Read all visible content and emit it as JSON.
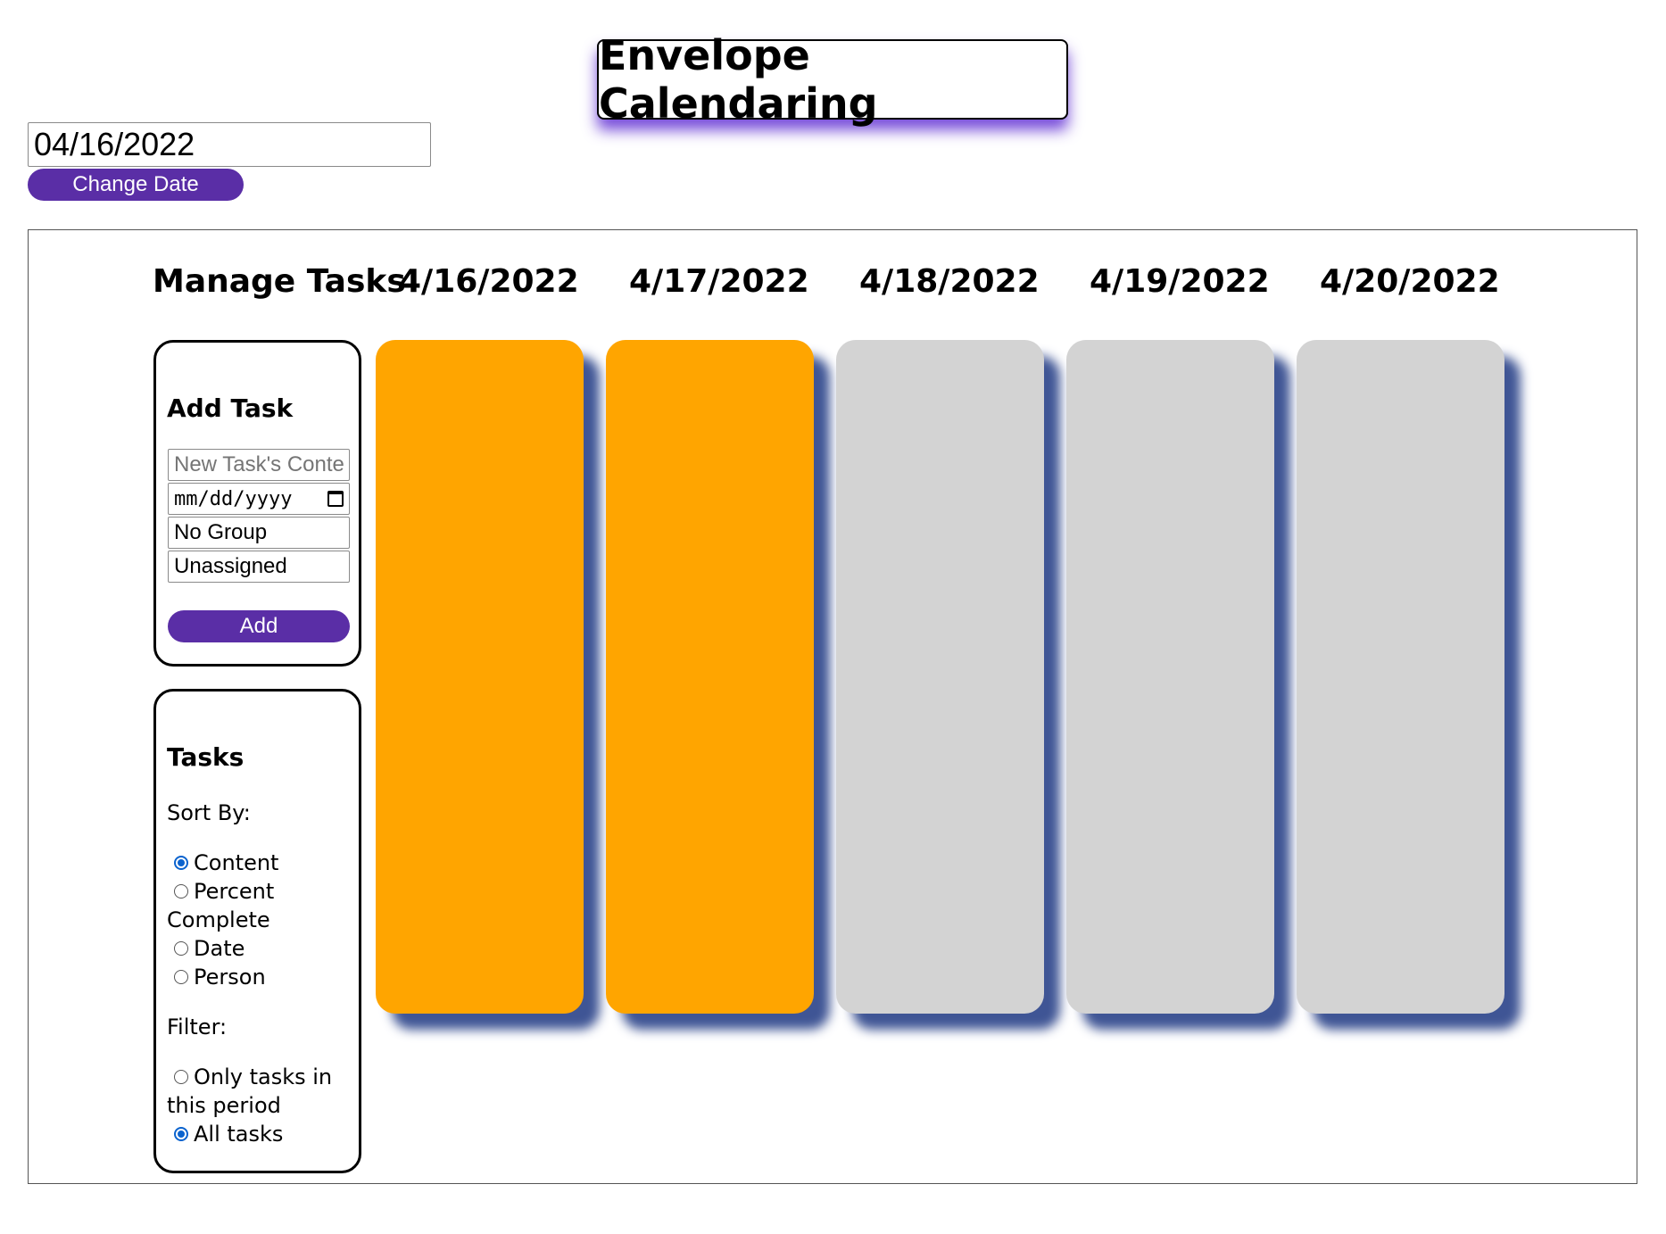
{
  "app": {
    "title": "Envelope Calendaring"
  },
  "date_picker": {
    "value": "04/16/2022",
    "button_label": "Change Date"
  },
  "manage": {
    "heading": "Manage Tasks"
  },
  "columns": [
    {
      "label": "4/16/2022",
      "color": "#FFA500"
    },
    {
      "label": "4/17/2022",
      "color": "#FFA500"
    },
    {
      "label": "4/18/2022",
      "color": "#D3D3D3"
    },
    {
      "label": "4/19/2022",
      "color": "#D3D3D3"
    },
    {
      "label": "4/20/2022",
      "color": "#D3D3D3"
    }
  ],
  "add_task": {
    "title": "Add Task",
    "content_placeholder": "New Task's Conte",
    "date_placeholder": "mm/dd/yyyy",
    "group_value": "No Group",
    "assignee_value": "Unassigned",
    "add_label": "Add"
  },
  "tasks_panel": {
    "title": "Tasks",
    "sort_label": "Sort By:",
    "sort_options": [
      {
        "label": "Content",
        "checked": true
      },
      {
        "label": "Percent",
        "checked": false
      },
      {
        "label": "Complete",
        "checked": false
      },
      {
        "label": "Date",
        "checked": false
      },
      {
        "label": "Person",
        "checked": false
      }
    ],
    "filter_label": "Filter:",
    "filter_options": [
      {
        "label": "Only tasks in",
        "cont": "this period",
        "checked": false
      },
      {
        "label": "All tasks",
        "checked": true
      }
    ]
  },
  "colors": {
    "accent": "#5A2EA6",
    "envelope_active": "#FFA500",
    "envelope_inactive": "#D3D3D3",
    "shadow": "#3F5595"
  }
}
